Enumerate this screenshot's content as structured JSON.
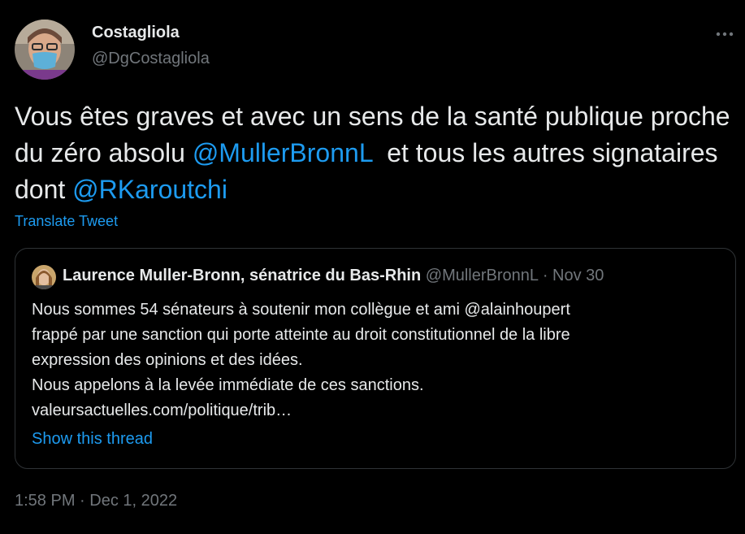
{
  "tweet": {
    "author_name": "Costagliola",
    "author_handle": "@DgCostagliola",
    "text_part1": "Vous êtes graves et avec un sens de la santé publique proche du zéro absolu ",
    "mention1": "@MullerBronnL",
    "text_part2": "  et tous les autres signataires dont ",
    "mention2": "@RKaroutchi",
    "translate_label": "Translate Tweet",
    "timestamp": "1:58 PM · Dec 1, 2022"
  },
  "quote": {
    "author_name": "Laurence Muller-Bronn, sénatrice du Bas-Rhin",
    "meta": " @MullerBronnL · Nov 30",
    "lines": [
      "Nous sommes 54 sénateurs à soutenir mon collègue et ami @alainhoupert",
      "frappé par une sanction qui porte atteinte au droit constitutionnel de la libre",
      "expression des opinions et des idées.",
      "Nous appelons à la levée immédiate de ces sanctions.",
      "valeursactuelles.com/politique/trib…"
    ],
    "show_thread_label": "Show this thread"
  },
  "icons": {
    "more": "more-horizontal-icon"
  },
  "colors": {
    "background": "#000000",
    "text": "#e7e9ea",
    "secondary": "#71767b",
    "accent": "#1d9bf0",
    "border": "#2f3336"
  }
}
